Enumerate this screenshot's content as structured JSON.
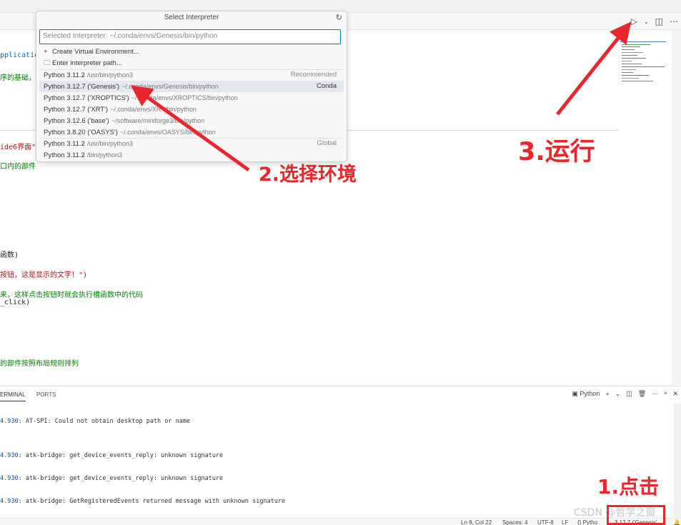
{
  "colors": {
    "accent": "#0078d4",
    "annotation_red": "#e8262b",
    "selected_row": "#e4e6f1"
  },
  "editor_actions": {
    "run_icon": "play-icon",
    "chevron": "chevron-down-icon",
    "split": "split-editor-icon",
    "more": "more-icon"
  },
  "code_lines": [
    {
      "text": "pplicatio",
      "color": "c-blue"
    },
    {
      "text": "序的基础，",
      "color": "c-green"
    },
    {
      "text": "ide6界面\"",
      "color": "c-red"
    },
    {
      "text": "口内的部件",
      "color": "c-green"
    },
    {
      "text": "函数)",
      "color": "c-dark"
    },
    {
      "text": "按钮，这是显示的文字！\")",
      "color": "c-red"
    },
    {
      "text": "来，这样点击按钮时就会执行槽函数中的代码",
      "color": "c-green"
    },
    {
      "text": "_click)",
      "color": "c-dark"
    },
    {
      "text": "的部件按照布局规则排列",
      "color": "c-green"
    }
  ],
  "quick_pick": {
    "title": "Select Interpreter",
    "input_placeholder": "Selected Interpreter: ~/.conda/envs/Genesis/bin/python",
    "create_env": "Create Virtual Environment...",
    "enter_path": "Enter interpreter path...",
    "items": [
      {
        "name": "Python 3.11.2",
        "path": "/usr/bin/python3",
        "tag": "Recommended"
      },
      {
        "name": "Python 3.12.7 ('Genesis')",
        "path": "~/.conda/envs/Genesis/bin/python",
        "tag": "Conda"
      },
      {
        "name": "Python 3.12.7 ('XROPTICS')",
        "path": "~/.conda/envs/XROPTICS/bin/python",
        "tag": ""
      },
      {
        "name": "Python 3.12.7 ('XRT')",
        "path": "~/.conda/envs/XRT/bin/python",
        "tag": ""
      },
      {
        "name": "Python 3.12.6 ('base')",
        "path": "~/software/miniforge3/bin/python",
        "tag": ""
      },
      {
        "name": "Python 3.8.20 ('OASYS')",
        "path": "~/.conda/envs/OASYS/bin/python",
        "tag": ""
      },
      {
        "name": "Python 3.11.2",
        "path": "/usr/bin/python3",
        "tag": "Global"
      },
      {
        "name": "Python 3.11.2",
        "path": "/bin/python3",
        "tag": ""
      }
    ]
  },
  "panel": {
    "tabs": [
      "ERMINAL",
      "PORTS"
    ],
    "shell_label": "Python",
    "terminal_lines": [
      {
        "num": "4.930",
        "text": ": AT-SPI: Could not obtain desktop path or name"
      },
      {
        "num": "4.930",
        "text": ": atk-bridge: get_device_events_reply: unknown signature"
      },
      {
        "num": "4.930",
        "text": ": atk-bridge: get_device_events_reply: unknown signature"
      },
      {
        "num": "4.930",
        "text": ": atk-bridge: GetRegisteredEvents returned message with unknown signature"
      }
    ]
  },
  "status_bar": {
    "position": "Ln 9, Col 22",
    "spaces": "Spaces: 4",
    "encoding": "UTF-8",
    "eol": "LF",
    "language": "{} Pytho",
    "interpreter": "3.12.7 ('Genesis'"
  },
  "annotations": {
    "step1": "1.点击",
    "step2": "2.选择环境",
    "step3": "3.运行",
    "watermark": "CSDN @哲学之窗"
  }
}
